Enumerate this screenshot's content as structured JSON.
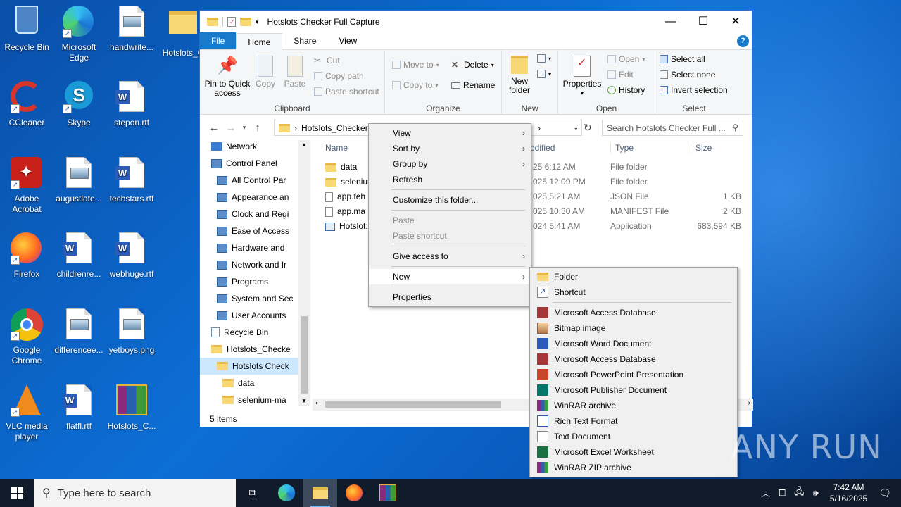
{
  "desktop": {
    "icons": [
      {
        "label": "Recycle Bin",
        "icon": "recycle-bin-icon"
      },
      {
        "label": "Microsoft Edge",
        "icon": "edge-icon"
      },
      {
        "label": "handwrite...",
        "icon": "image-file-icon"
      },
      {
        "label": "Hotslots_C",
        "icon": "folder-icon"
      },
      {
        "label": "CCleaner",
        "icon": "ccleaner-icon"
      },
      {
        "label": "Skype",
        "icon": "skype-icon"
      },
      {
        "label": "stepon.rtf",
        "icon": "word-doc-icon"
      },
      {
        "label": "Adobe Acrobat",
        "icon": "acrobat-icon"
      },
      {
        "label": "augustlate...",
        "icon": "image-file-icon"
      },
      {
        "label": "techstars.rtf",
        "icon": "word-doc-icon"
      },
      {
        "label": "Firefox",
        "icon": "firefox-icon"
      },
      {
        "label": "childrenre...",
        "icon": "word-doc-icon"
      },
      {
        "label": "webhuge.rtf",
        "icon": "word-doc-icon"
      },
      {
        "label": "Google Chrome",
        "icon": "chrome-icon"
      },
      {
        "label": "differencee...",
        "icon": "image-file-icon"
      },
      {
        "label": "yetboys.png",
        "icon": "image-file-icon"
      },
      {
        "label": "VLC media player",
        "icon": "vlc-icon"
      },
      {
        "label": "flatfl.rtf",
        "icon": "word-doc-icon"
      },
      {
        "label": "Hotslots_C...",
        "icon": "winrar-icon"
      }
    ]
  },
  "window": {
    "title": "Hotslots Checker Full Capture",
    "tabs": {
      "file": "File",
      "home": "Home",
      "share": "Share",
      "view": "View"
    },
    "ribbon": {
      "pin": "Pin to Quick access",
      "copy": "Copy",
      "paste": "Paste",
      "cut": "Cut",
      "copy_path": "Copy path",
      "paste_shortcut": "Paste shortcut",
      "clipboard_label": "Clipboard",
      "move_to": "Move to",
      "copy_to": "Copy to",
      "delete": "Delete",
      "rename": "Rename",
      "organize_label": "Organize",
      "new_folder": "New folder",
      "new_label": "New",
      "properties": "Properties",
      "open": "Open",
      "edit": "Edit",
      "history": "History",
      "open_label": "Open",
      "select_all": "Select all",
      "select_none": "Select none",
      "invert_selection": "Invert selection",
      "select_label": "Select"
    },
    "address": "Hotslots_Checker",
    "search_placeholder": "Search Hotslots Checker Full ...",
    "nav": [
      {
        "label": "Network",
        "indent": 1
      },
      {
        "label": "Control Panel",
        "indent": 1
      },
      {
        "label": "All Control Par",
        "indent": 2
      },
      {
        "label": "Appearance an",
        "indent": 2
      },
      {
        "label": "Clock and Regi",
        "indent": 2
      },
      {
        "label": "Ease of Access",
        "indent": 2
      },
      {
        "label": "Hardware and",
        "indent": 2
      },
      {
        "label": "Network and Ir",
        "indent": 2
      },
      {
        "label": "Programs",
        "indent": 2
      },
      {
        "label": "System and Sec",
        "indent": 2
      },
      {
        "label": "User Accounts",
        "indent": 2
      },
      {
        "label": "Recycle Bin",
        "indent": 1
      },
      {
        "label": "Hotslots_Checke",
        "indent": 1
      },
      {
        "label": "Hotslots Check",
        "indent": 2
      },
      {
        "label": "data",
        "indent": 3
      },
      {
        "label": "selenium-ma",
        "indent": 3
      }
    ],
    "columns": {
      "name": "Name",
      "modified": "odified",
      "type": "Type",
      "size": "Size"
    },
    "files": [
      {
        "name": "data",
        "modified": "25 6:12 AM",
        "type": "File folder",
        "size": ""
      },
      {
        "name": "seleniur",
        "modified": "025 12:09 PM",
        "type": "File folder",
        "size": ""
      },
      {
        "name": "app.feh",
        "modified": "025 5:21 AM",
        "type": "JSON File",
        "size": "1 KB"
      },
      {
        "name": "app.ma",
        "modified": "025 10:30 AM",
        "type": "MANIFEST File",
        "size": "2 KB"
      },
      {
        "name": "Hotslot:",
        "modified": "024 5:41 AM",
        "type": "Application",
        "size": "683,594 KB"
      }
    ],
    "status": "5 items"
  },
  "context_menu": {
    "items": [
      "View",
      "Sort by",
      "Group by",
      "Refresh",
      "Customize this folder...",
      "Paste",
      "Paste shortcut",
      "Give access to",
      "New",
      "Properties"
    ]
  },
  "new_submenu": {
    "items": [
      {
        "label": "Folder",
        "icon": "folder-icon"
      },
      {
        "label": "Shortcut",
        "icon": "shortcut-icon"
      },
      {
        "label": "Microsoft Access Database",
        "icon": "access-icon"
      },
      {
        "label": "Bitmap image",
        "icon": "bitmap-icon"
      },
      {
        "label": "Microsoft Word Document",
        "icon": "word-icon"
      },
      {
        "label": "Microsoft Access Database",
        "icon": "access-icon"
      },
      {
        "label": "Microsoft PowerPoint Presentation",
        "icon": "powerpoint-icon"
      },
      {
        "label": "Microsoft Publisher Document",
        "icon": "publisher-icon"
      },
      {
        "label": "WinRAR archive",
        "icon": "winrar-icon"
      },
      {
        "label": "Rich Text Format",
        "icon": "rtf-icon"
      },
      {
        "label": "Text Document",
        "icon": "text-icon"
      },
      {
        "label": "Microsoft Excel Worksheet",
        "icon": "excel-icon"
      },
      {
        "label": "WinRAR ZIP archive",
        "icon": "winrar-zip-icon"
      }
    ]
  },
  "taskbar": {
    "search_placeholder": "Type here to search",
    "time": "7:42 AM",
    "date": "5/16/2025"
  },
  "watermark": "ANY RUN"
}
